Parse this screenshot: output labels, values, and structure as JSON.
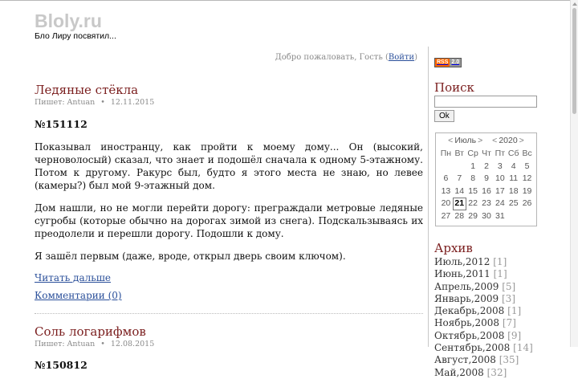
{
  "header": {
    "site_title": "Bloly.ru",
    "tagline": "Бло Лиру посвятил...",
    "welcome_prefix": "Добро пожаловать, Гость (",
    "login_link": "Войти",
    "welcome_suffix": ")"
  },
  "posts": [
    {
      "title": "Ледяные стёкла",
      "author_label": "Пишет: Antuan",
      "separator": "•",
      "date": "12.11.2015",
      "number": "№151112",
      "paragraphs": [
        "Показывал иностранцу, как пройти к моему дому... Он (высокий, черноволосый) сказал, что знает и подошёл сначала к одному 5-этажному. Потом к другому. Ракурс был, будто я этого места не знаю, но левее (камеры?) был мой 9-этажный дом.",
        "Дом нашли, но не могли перейти дорогу: преграждали метровые ледяные сугробы (которые обычно на дорогах зимой из снега). Подскальзываясь их преодолели и перешли дорогу. Подошли к дому.",
        "Я зашёл первым (даже, вроде, открыл дверь своим ключом)."
      ],
      "read_more": "Читать дальше",
      "comments": "Комментарии (0)"
    },
    {
      "title": "Соль логарифмов",
      "author_label": "Пишет: Antuan",
      "separator": "•",
      "date": "12.08.2015",
      "number": "№150812"
    }
  ],
  "sidebar": {
    "rss_left": "RSS",
    "rss_right": "2.0",
    "search_title": "Поиск",
    "search_value": "",
    "ok_label": "Ok",
    "calendar": {
      "prev_month_arrow": "<",
      "month": "Июль",
      "next_month_arrow": ">",
      "prev_year_arrow": "<",
      "year": "2020",
      "next_year_arrow": ">",
      "weekdays": [
        "Пн",
        "Вт",
        "Ср",
        "Чт",
        "Пт",
        "Сб",
        "Вс"
      ],
      "weeks": [
        [
          "",
          "",
          "1",
          "2",
          "3",
          "4",
          "5"
        ],
        [
          "6",
          "7",
          "8",
          "9",
          "10",
          "11",
          "12"
        ],
        [
          "13",
          "14",
          "15",
          "16",
          "17",
          "18",
          "19"
        ],
        [
          "20",
          "21",
          "22",
          "23",
          "24",
          "25",
          "26"
        ],
        [
          "27",
          "28",
          "29",
          "30",
          "31",
          "",
          ""
        ]
      ],
      "today": "21"
    },
    "archive_title": "Архив",
    "archive": [
      {
        "label": "Июль,2012",
        "count": "[1]"
      },
      {
        "label": "Июнь,2011",
        "count": "[1]"
      },
      {
        "label": "Апрель,2009",
        "count": "[5]"
      },
      {
        "label": "Январь,2009",
        "count": "[3]"
      },
      {
        "label": "Декабрь,2008",
        "count": "[1]"
      },
      {
        "label": "Ноябрь,2008",
        "count": "[7]"
      },
      {
        "label": "Октябрь,2008",
        "count": "[9]"
      },
      {
        "label": "Сентябрь,2008",
        "count": "[14]"
      },
      {
        "label": "Август,2008",
        "count": "[35]"
      },
      {
        "label": "Май,2008",
        "count": "[32]"
      }
    ]
  }
}
